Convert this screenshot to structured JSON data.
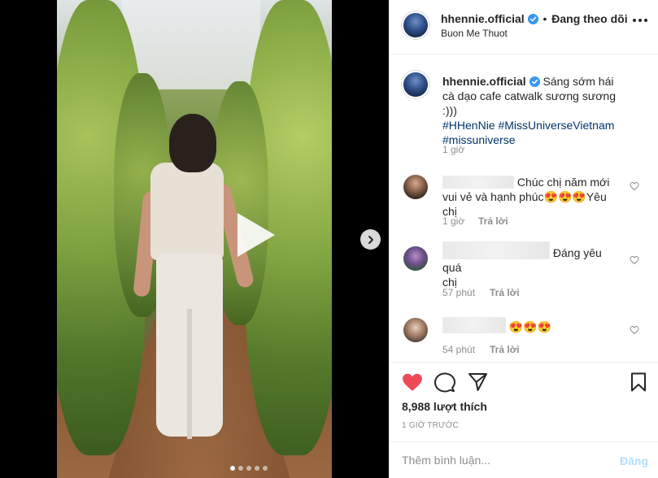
{
  "post": {
    "username": "hhennie.official",
    "follow_state": "Đang theo dõi",
    "separator": "•",
    "location": "Buon Me Thuot"
  },
  "caption": {
    "username": "hhennie.official",
    "text": "Sáng sớm hái cà dạo cafe catwalk sương sương :)))",
    "hashtags": [
      "#HHenNie",
      "#MissUniverseVietnam",
      "#missuniverse"
    ],
    "time": "1 giờ"
  },
  "comments": [
    {
      "text_line1": "Chúc chị năm mới",
      "text_line2": "vui vẻ và hạnh phúc😍😍😍Yêu chị",
      "time": "1 giờ",
      "reply": "Trả lời"
    },
    {
      "text_line1": "Đáng yêu quá",
      "text_line2": "chị",
      "time": "57 phút",
      "reply": "Trả lời"
    },
    {
      "text_line1": "😍😍😍",
      "time": "54 phút",
      "reply": "Trả lời"
    }
  ],
  "stats": {
    "likes": "8,988 lượt thích",
    "posted_ago": "1 GIỜ TRƯỚC"
  },
  "comment_box": {
    "placeholder": "Thêm bình luận...",
    "post_label": "Đăng"
  },
  "media": {
    "carousel_count": 5,
    "carousel_active": 1
  },
  "colors": {
    "like_red": "#ed4956",
    "verified_blue": "#3897f0",
    "hashtag": "#003569",
    "post_disabled": "#b2dffc"
  }
}
